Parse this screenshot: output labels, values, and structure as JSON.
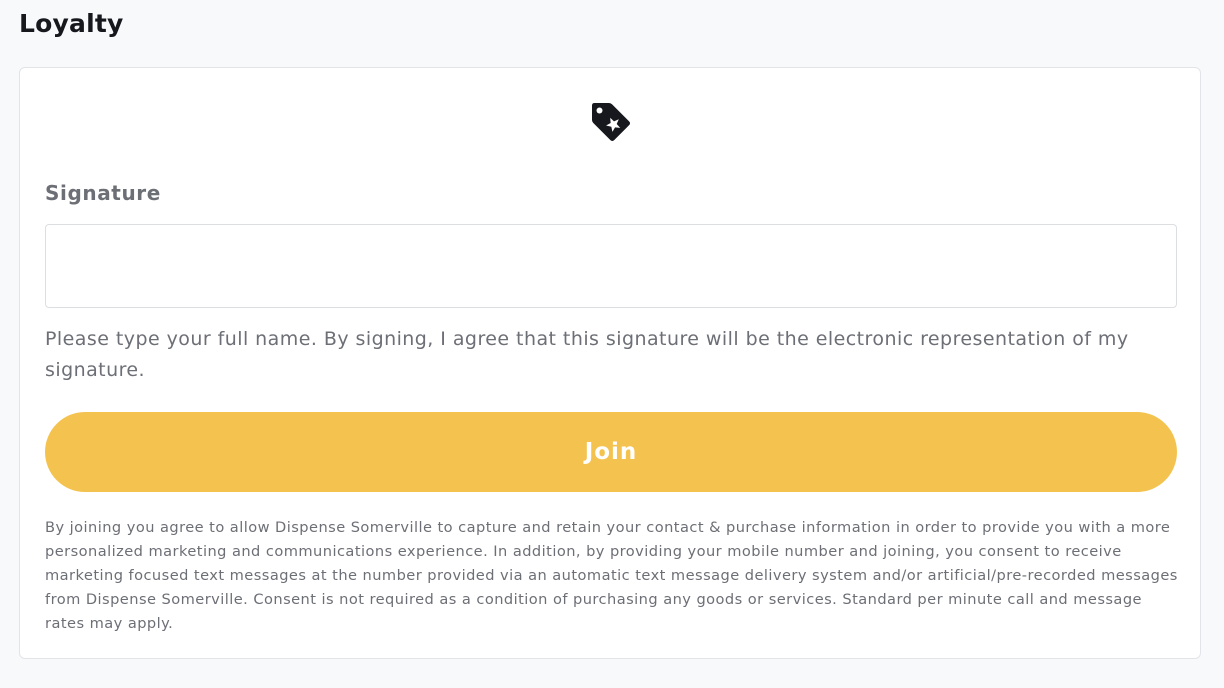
{
  "page": {
    "title": "Loyalty"
  },
  "card": {
    "icon": "discount-tag-icon",
    "signature": {
      "label": "Signature",
      "value": "",
      "placeholder": ""
    },
    "helper_text": "Please type your full name. By signing, I agree that this signature will be the electronic representation of my signature.",
    "join_label": "Join",
    "disclaimer": "By joining you agree to allow Dispense Somerville to capture and retain your contact & purchase information in order to provide you with a more personalized marketing and communications experience. In addition, by providing your mobile number and joining, you consent to receive marketing focused text messages at the number provided via an automatic text message delivery system and/or artificial/pre-recorded messages from Dispense Somerville. Consent is not required as a condition of purchasing any goods or services. Standard per minute call and message rates may apply."
  },
  "colors": {
    "background": "#f8f9fb",
    "card": "#ffffff",
    "join_button": "#f4c34f",
    "title_text": "#16181d",
    "muted_text": "#6d6f76"
  }
}
